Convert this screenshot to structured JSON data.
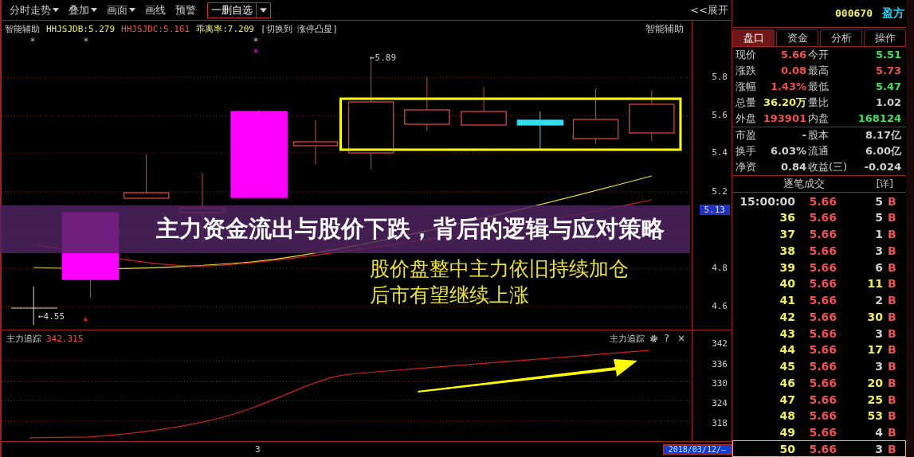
{
  "toolbar": {
    "menus": [
      {
        "label": "分时走势",
        "dropdown": true
      },
      {
        "label": "叠加",
        "dropdown": true
      },
      {
        "label": "画面",
        "dropdown": true
      },
      {
        "label": "画线",
        "dropdown": false
      },
      {
        "label": "预警",
        "dropdown": false
      }
    ],
    "watchlist_button": "一删自选",
    "expand_button": "<<展开"
  },
  "chart": {
    "indicator_name": "智能辅助",
    "readouts": [
      {
        "label": "HHJSJDB:5.279",
        "color": "#f0f060"
      },
      {
        "label": "HHJSJDC:5.161",
        "color": "#f05050"
      },
      {
        "label": "乖离率:7.209",
        "color": "#f0f060"
      },
      {
        "label": "[切换到 涨停凸显]"
      }
    ],
    "signal_marks": [
      {
        "symbol": "*",
        "kind": "plain"
      },
      {
        "symbol": "*",
        "kind": "plain"
      },
      {
        "symbol": "*",
        "kind": "plain"
      },
      {
        "symbol": "*",
        "kind": "strong"
      }
    ],
    "indicator_label_right": "智能辅助",
    "high_label": "←5.89",
    "low_label": "←4.55",
    "annotation": [
      "股价盘整中主力依旧持续加仓",
      "后市有望继续上涨"
    ],
    "price_ticks": [
      "5.8",
      "5.6",
      "5.4",
      "5.2",
      "4.8",
      "4.6"
    ],
    "current_price": "5.13"
  },
  "indicator": {
    "name": "主力追踪",
    "value": "342.315",
    "name_right": "主力追踪",
    "help": "?",
    "close": "×",
    "ticks": [
      "342",
      "336",
      "330",
      "324",
      "318"
    ]
  },
  "footer": {
    "period": "3",
    "date": "2018/03/12/—"
  },
  "banner": {
    "title": "主力资金流出与股价下跌，背后的逻辑与应对策略"
  },
  "stock": {
    "code": "000670",
    "name": "盈方"
  },
  "tabs": [
    {
      "label": "盘口",
      "selected": true
    },
    {
      "label": "资金",
      "selected": false
    },
    {
      "label": "分析",
      "selected": false
    },
    {
      "label": "操作",
      "selected": false
    }
  ],
  "quote_items": [
    {
      "label": "现价",
      "value": "5.66",
      "color": "#f05050"
    },
    {
      "label": "今开",
      "value": "5.51",
      "color": "#40e060"
    },
    {
      "label": "涨跌",
      "value": "0.08",
      "color": "#f05050"
    },
    {
      "label": "最高",
      "value": "5.73",
      "color": "#f05050"
    },
    {
      "label": "涨幅",
      "value": "1.43%",
      "color": "#f05050"
    },
    {
      "label": "最低",
      "value": "5.47",
      "color": "#40e060"
    },
    {
      "label": "总量",
      "value": "36.20万",
      "color": "#f0f060"
    },
    {
      "label": "量比",
      "value": "1.02"
    },
    {
      "label": "外盘",
      "value": "193901",
      "color": "#f05050"
    },
    {
      "label": "内盘",
      "value": "168124",
      "color": "#40e060"
    }
  ],
  "stats_rows": [
    {
      "label": "市盈",
      "value": "-",
      "label2": "股本",
      "value2": "8.17亿"
    },
    {
      "label": "换手",
      "value": "6.03%",
      "label2": "流通",
      "value2": "6.00亿"
    },
    {
      "label": "净资",
      "value": "0.84",
      "label2": "收益(三)",
      "value2": "-0.024"
    }
  ],
  "ticks_panel": {
    "title": "逐笔成交",
    "detail": "[详]",
    "rows": [
      {
        "time": "15:00:00",
        "price": "5.66",
        "volume": "5",
        "side": "B",
        "large": false,
        "selected": false
      },
      {
        "time": "36",
        "price": "5.66",
        "volume": "5",
        "side": "B",
        "large": false,
        "selected": false
      },
      {
        "time": "37",
        "price": "5.66",
        "volume": "1",
        "side": "B",
        "large": false,
        "selected": false
      },
      {
        "time": "38",
        "price": "5.66",
        "volume": "3",
        "side": "B",
        "large": false,
        "selected": false
      },
      {
        "time": "39",
        "price": "5.66",
        "volume": "6",
        "side": "B",
        "large": false,
        "selected": false
      },
      {
        "time": "40",
        "price": "5.66",
        "volume": "11",
        "side": "B",
        "large": true,
        "selected": false
      },
      {
        "time": "41",
        "price": "5.66",
        "volume": "2",
        "side": "B",
        "large": false,
        "selected": false
      },
      {
        "time": "42",
        "price": "5.66",
        "volume": "30",
        "side": "B",
        "large": true,
        "selected": false
      },
      {
        "time": "43",
        "price": "5.66",
        "volume": "3",
        "side": "B",
        "large": false,
        "selected": false
      },
      {
        "time": "44",
        "price": "5.66",
        "volume": "17",
        "side": "B",
        "large": true,
        "selected": false
      },
      {
        "time": "45",
        "price": "5.66",
        "volume": "3",
        "side": "B",
        "large": false,
        "selected": false
      },
      {
        "time": "46",
        "price": "5.66",
        "volume": "20",
        "side": "B",
        "large": true,
        "selected": false
      },
      {
        "time": "47",
        "price": "5.66",
        "volume": "25",
        "side": "B",
        "large": true,
        "selected": false
      },
      {
        "time": "48",
        "price": "5.66",
        "volume": "53",
        "side": "B",
        "large": true,
        "selected": false
      },
      {
        "time": "49",
        "price": "5.66",
        "volume": "4",
        "side": "B",
        "large": false,
        "selected": false
      },
      {
        "time": "50",
        "price": "5.66",
        "volume": "3",
        "side": "B",
        "large": false,
        "selected": true
      }
    ]
  }
}
